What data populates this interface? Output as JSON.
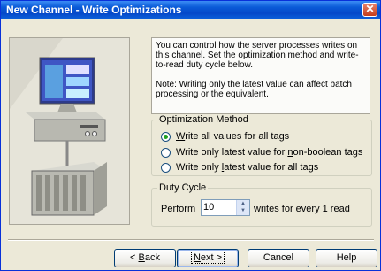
{
  "window": {
    "title": "New Channel - Write Optimizations",
    "close_glyph": "✕"
  },
  "description": {
    "paragraph1": "You can control how the server processes writes on this channel.  Set the optimization method and write-to-read duty cycle below.",
    "paragraph2": "Note:  Writing only the latest value can affect batch processing or the equivalent."
  },
  "optimization": {
    "legend": "Optimization Method",
    "options": [
      {
        "label_pre": "",
        "accel": "W",
        "label_post": "rite all values for all tags",
        "selected": true
      },
      {
        "label_pre": "Write only latest value for ",
        "accel": "n",
        "label_post": "on-boolean tags",
        "selected": false
      },
      {
        "label_pre": "Write only ",
        "accel": "l",
        "label_post": "atest value for all tags",
        "selected": false
      }
    ]
  },
  "duty_cycle": {
    "legend": "Duty Cycle",
    "perform_accel": "P",
    "perform_rest": "erform",
    "value": "10",
    "suffix": "writes for every 1 read"
  },
  "buttons": {
    "back_pre": "< ",
    "back_accel": "B",
    "back_post": "ack",
    "next_accel": "N",
    "next_post": "ext >",
    "cancel": "Cancel",
    "help": "Help"
  },
  "colors": {
    "titlebar": "#0a5bd8",
    "dialog_bg": "#ece9d8",
    "radio_dot": "#21a121"
  }
}
